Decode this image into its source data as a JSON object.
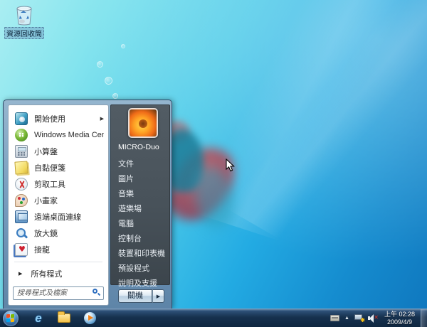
{
  "desktop": {
    "recycle_bin_label": "資源回收筒"
  },
  "start_menu": {
    "left_items": [
      {
        "label": "開始使用",
        "icon": "getting-started-icon",
        "has_submenu": true,
        "submenu_arrow": "▶"
      },
      {
        "label": "Windows Media Center",
        "icon": "windows-media-center-icon"
      },
      {
        "label": "小算盤",
        "icon": "calculator-icon"
      },
      {
        "label": "自黏便箋",
        "icon": "sticky-notes-icon"
      },
      {
        "label": "剪取工具",
        "icon": "snipping-tool-icon"
      },
      {
        "label": "小畫家",
        "icon": "paint-icon"
      },
      {
        "label": "遠端桌面連線",
        "icon": "remote-desktop-icon"
      },
      {
        "label": "放大鏡",
        "icon": "magnifier-icon"
      },
      {
        "label": "接龍",
        "icon": "solitaire-icon"
      }
    ],
    "all_programs": {
      "label": "所有程式",
      "arrow": "▶"
    },
    "search": {
      "placeholder": "搜尋程式及檔案"
    },
    "user_name": "MICRO-Duo",
    "right_items": [
      "文件",
      "圖片",
      "音樂",
      "遊樂場",
      "電腦",
      "控制台",
      "裝置和印表機",
      "預設程式",
      "說明及支援"
    ],
    "shutdown": {
      "label": "關機",
      "arrow": "▶"
    }
  },
  "taskbar": {
    "tray_expand_arrow": "▲",
    "network_badge": "✱",
    "mute_badge": "✕",
    "clock_time": "上午 02:28",
    "clock_date": "2009/4/9"
  },
  "colors": {
    "desktop_top": "#84e4ee",
    "desktop_bottom": "#0f76bd",
    "taskbar": "#16314e",
    "menu_glass": "#7396b9",
    "right_panel": "#48525a",
    "right_text": "#e9eef3",
    "left_text": "#2b2b2b"
  }
}
